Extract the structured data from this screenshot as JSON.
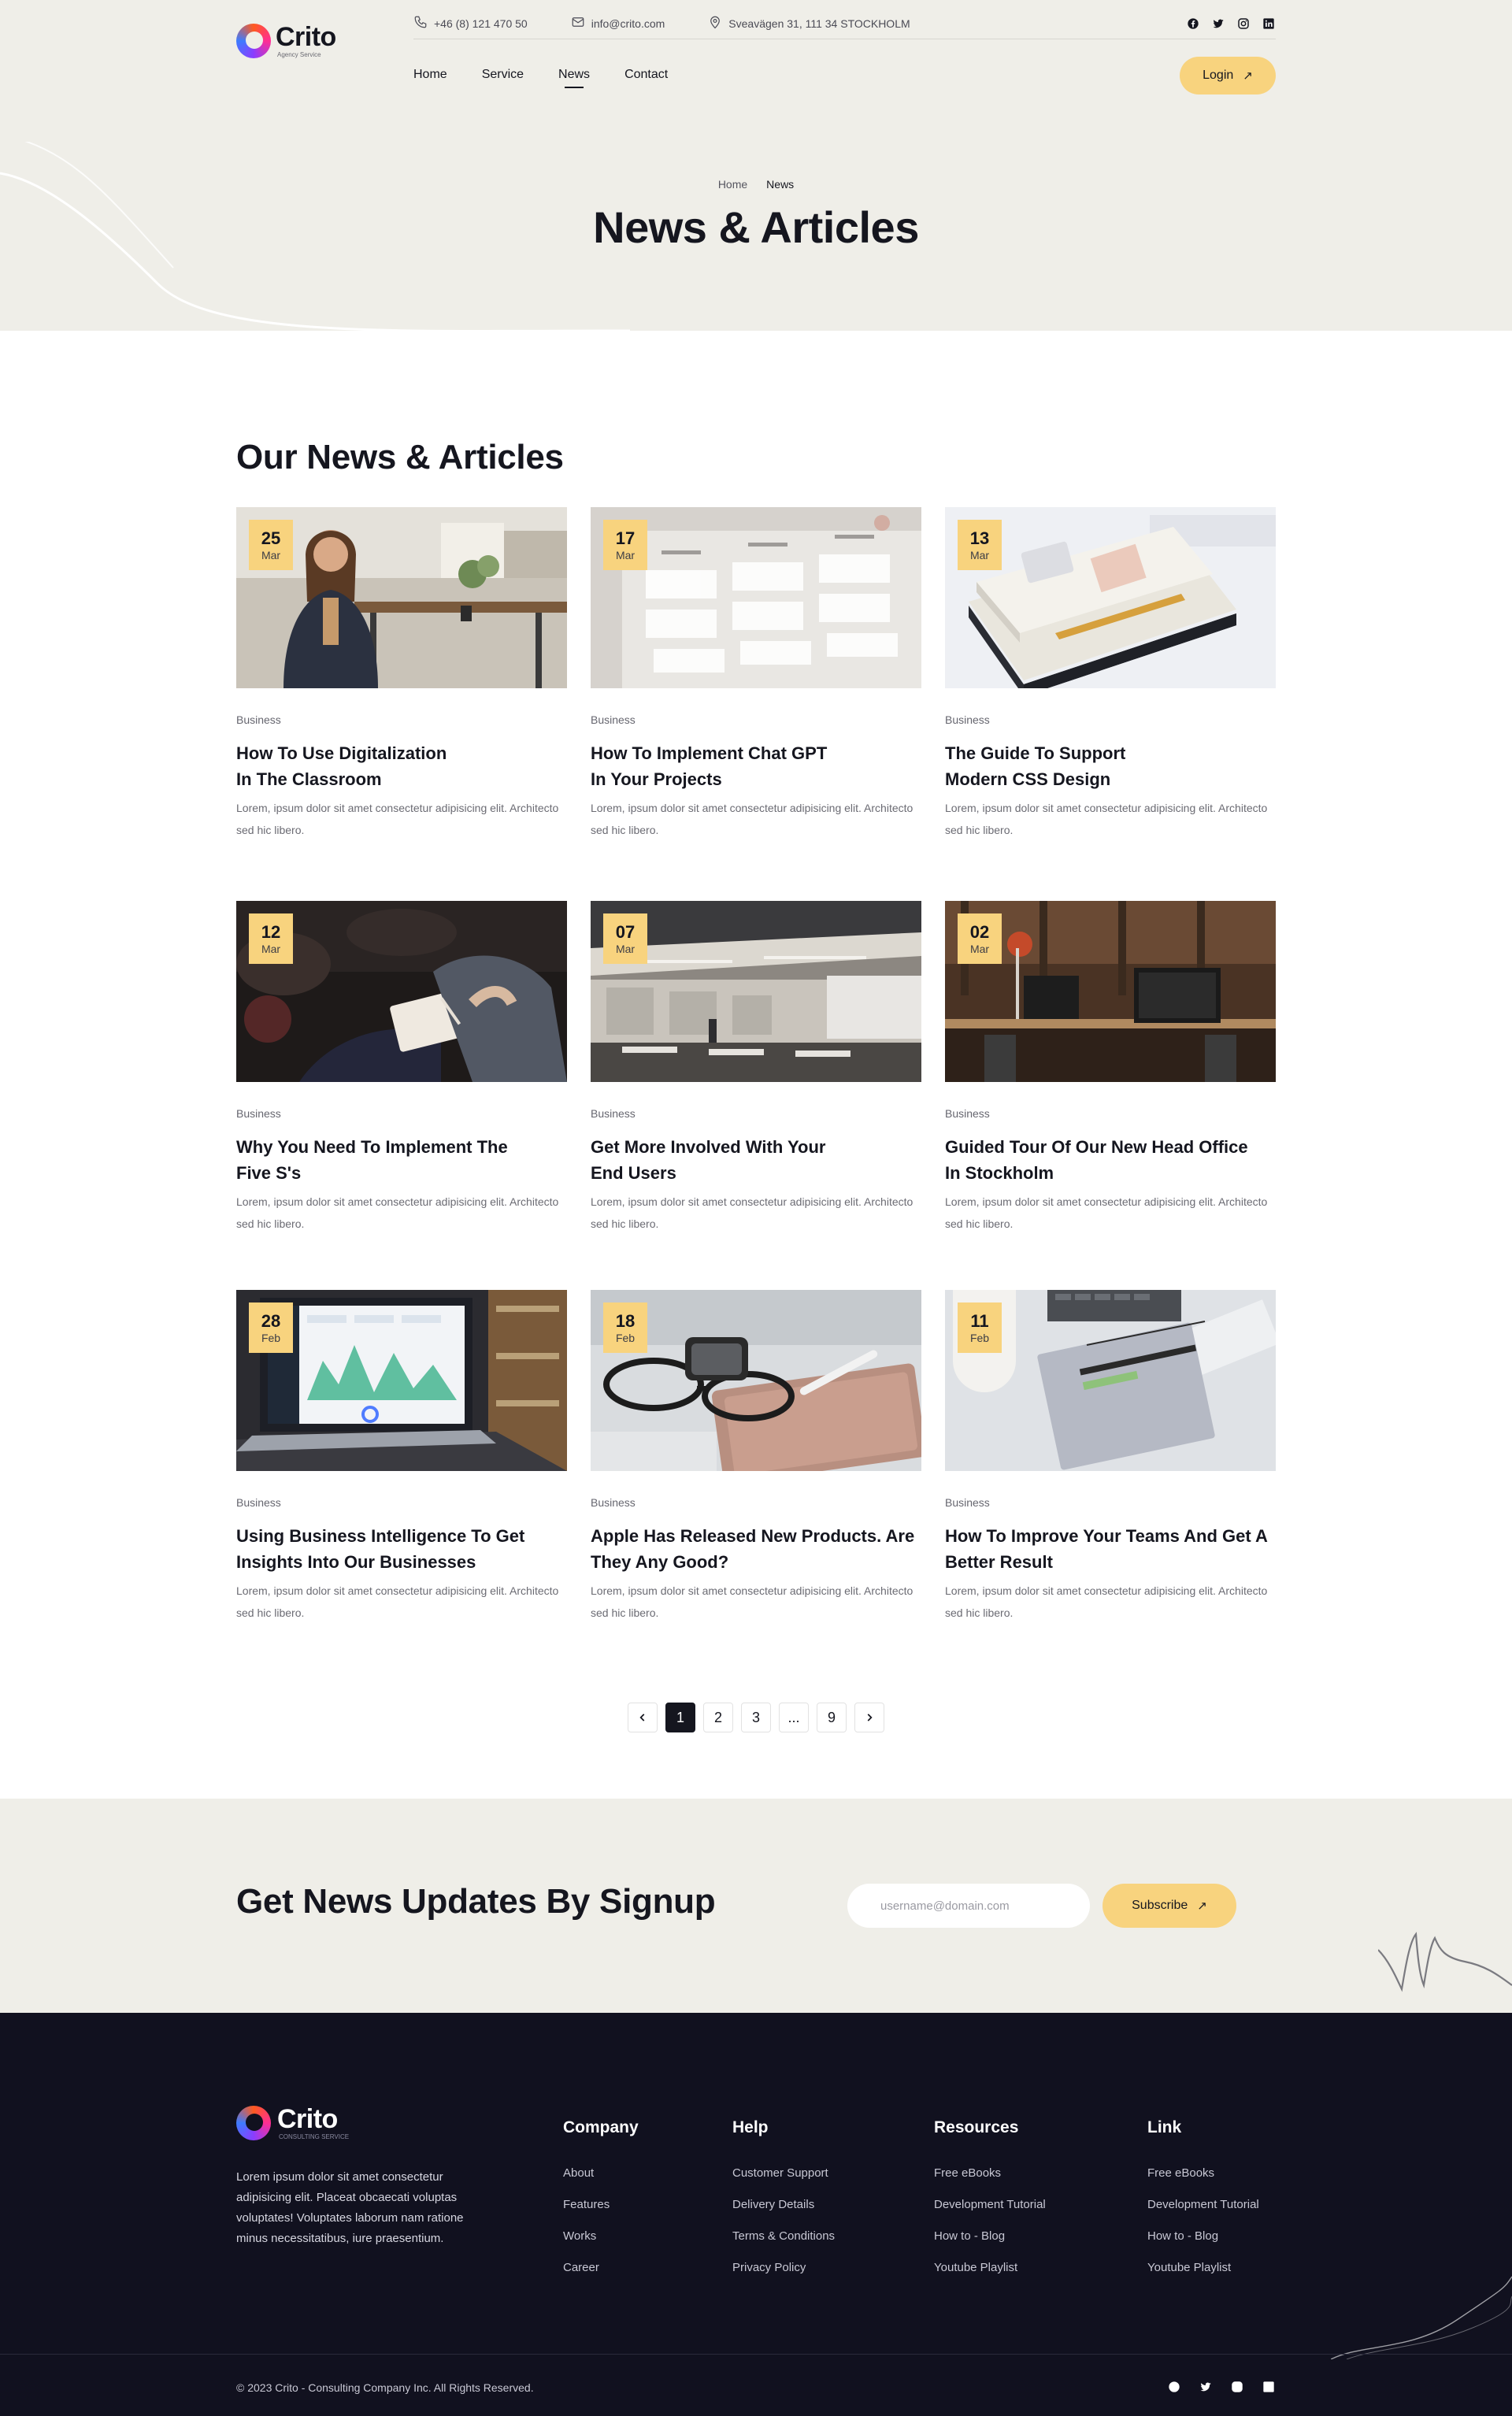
{
  "brand": {
    "name": "Crito",
    "tagline": "Agency Service",
    "footer_tagline": "CONSULTING SERVICE"
  },
  "contact": {
    "phone": "+46 (8) 121 470 50",
    "email": "info@crito.com",
    "address": "Sveavägen 31, 111 34 STOCKHOLM"
  },
  "socials": [
    "facebook-icon",
    "twitter-icon",
    "instagram-icon",
    "linkedin-icon"
  ],
  "nav": {
    "items": [
      {
        "label": "Home",
        "active": false
      },
      {
        "label": "Service",
        "active": false
      },
      {
        "label": "News",
        "active": true
      },
      {
        "label": "Contact",
        "active": false
      }
    ],
    "login_label": "Login"
  },
  "hero": {
    "breadcrumb": [
      "Home",
      "News"
    ],
    "title": "News & Articles"
  },
  "news": {
    "title": "Our News & Articles",
    "articles": [
      {
        "day": "25",
        "month": "Mar",
        "category": "Business",
        "title": "How To Use Digitalization\nIn The Classroom",
        "excerpt": "Lorem, ipsum dolor sit amet consectetur adipisicing elit. Architecto sed hic libero.",
        "image": "woman-office"
      },
      {
        "day": "17",
        "month": "Mar",
        "category": "Business",
        "title": "How To Implement Chat GPT\nIn Your Projects",
        "excerpt": "Lorem, ipsum dolor sit amet consectetur adipisicing elit. Architecto sed hic libero.",
        "image": "chatgpt-screen"
      },
      {
        "day": "13",
        "month": "Mar",
        "category": "Business",
        "title": "The Guide To Support\nModern CSS Design",
        "excerpt": "Lorem, ipsum dolor sit amet consectetur adipisicing elit. Architecto sed hic libero.",
        "image": "css-books"
      },
      {
        "day": "12",
        "month": "Mar",
        "category": "Business",
        "title": "Why You Need To Implement The\nFive S's",
        "excerpt": "Lorem, ipsum dolor sit amet consectetur adipisicing elit. Architecto sed hic libero.",
        "image": "notebook-writing"
      },
      {
        "day": "07",
        "month": "Mar",
        "category": "Business",
        "title": "Get More Involved With Your\nEnd Users",
        "excerpt": "Lorem, ipsum dolor sit amet consectetur adipisicing elit. Architecto sed hic libero.",
        "image": "open-office"
      },
      {
        "day": "02",
        "month": "Mar",
        "category": "Business",
        "title": "Guided Tour Of Our New Head Office\nIn Stockholm",
        "excerpt": "Lorem, ipsum dolor sit amet consectetur adipisicing elit. Architecto sed hic libero.",
        "image": "head-office"
      },
      {
        "day": "28",
        "month": "Feb",
        "category": "Business",
        "title": "Using Business Intelligence To Get\nInsights Into Our Businesses",
        "excerpt": "Lorem, ipsum dolor sit amet consectetur adipisicing elit. Architecto sed hic libero.",
        "image": "laptop-dashboard"
      },
      {
        "day": "18",
        "month": "Feb",
        "category": "Business",
        "title": "Apple Has Released New Products. Are\nThey Any Good?",
        "excerpt": "Lorem, ipsum dolor sit amet consectetur adipisicing elit. Architecto sed hic libero.",
        "image": "glasses-tablet"
      },
      {
        "day": "11",
        "month": "Feb",
        "category": "Business",
        "title": "How To Improve Your Teams And Get A\nBetter Result",
        "excerpt": "Lorem, ipsum dolor sit amet consectetur adipisicing elit. Architecto sed hic libero.",
        "image": "notebook-desk"
      }
    ]
  },
  "pagination": {
    "prev_icon": "chevron-left-icon",
    "next_icon": "chevron-right-icon",
    "pages": [
      "1",
      "2",
      "3",
      "...",
      "9"
    ],
    "current": "1"
  },
  "newsletter": {
    "title": "Get News Updates By Signup",
    "placeholder": "username@domain.com",
    "button_label": "Subscribe"
  },
  "footer": {
    "about": "Lorem ipsum dolor sit amet consectetur adipisicing elit. Placeat obcaecati voluptas voluptates! Voluptates laborum nam ratione minus necessitatibus, iure praesentium.",
    "columns": [
      {
        "title": "Company",
        "links": [
          "About",
          "Features",
          "Works",
          "Career"
        ]
      },
      {
        "title": "Help",
        "links": [
          "Customer Support",
          "Delivery Details",
          "Terms & Conditions",
          "Privacy Policy"
        ]
      },
      {
        "title": "Resources",
        "links": [
          "Free eBooks",
          "Development Tutorial",
          "How to - Blog",
          "Youtube Playlist"
        ]
      },
      {
        "title": "Link",
        "links": [
          "Free eBooks",
          "Development Tutorial",
          "How to - Blog",
          "Youtube Playlist"
        ]
      }
    ],
    "copyright": "© 2023 Crito - Consulting Company Inc. All Rights Reserved."
  },
  "colors": {
    "accent": "#f8d37e",
    "hero_bg": "#efeee8",
    "footer_bg": "#11111f",
    "text": "#15161f"
  }
}
